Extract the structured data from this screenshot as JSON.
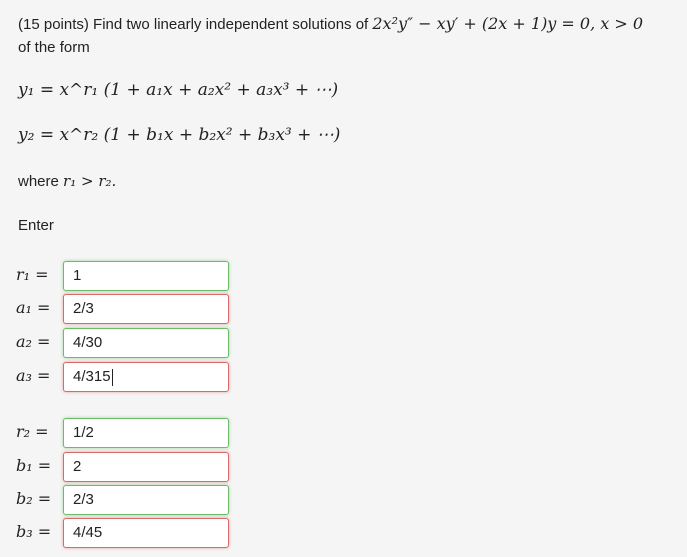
{
  "problem": {
    "prefix": "(15 points) Find two linearly independent solutions of ",
    "equation": "2x²y″ − xy′ + (2x + 1)y = 0,  x > 0",
    "suffix": "of the form"
  },
  "forms": {
    "y1": "y₁ = x^r₁ (1 + a₁x + a₂x² + a₃x³ + ⋯)",
    "y2": "y₂ = x^r₂ (1 + b₁x + b₂x² + b₃x³ + ⋯)"
  },
  "where": {
    "word": "where",
    "cond": "r₁ > r₂."
  },
  "enter_label": "Enter",
  "answers": [
    {
      "label": "r₁",
      "value": "1",
      "status": "correct"
    },
    {
      "label": "a₁",
      "value": "2/3",
      "status": "incorrect"
    },
    {
      "label": "a₂",
      "value": "4/30",
      "status": "correct"
    },
    {
      "label": "a₃",
      "value": "4/315",
      "status": "incorrect"
    },
    {
      "label": "r₂",
      "value": "1/2",
      "status": "correct"
    },
    {
      "label": "b₁",
      "value": "2",
      "status": "incorrect"
    },
    {
      "label": "b₂",
      "value": "2/3",
      "status": "correct"
    },
    {
      "label": "b₃",
      "value": "4/45",
      "status": "incorrect"
    }
  ],
  "colors": {
    "correct": "#6cbc6c",
    "incorrect": "#d86a6a"
  }
}
